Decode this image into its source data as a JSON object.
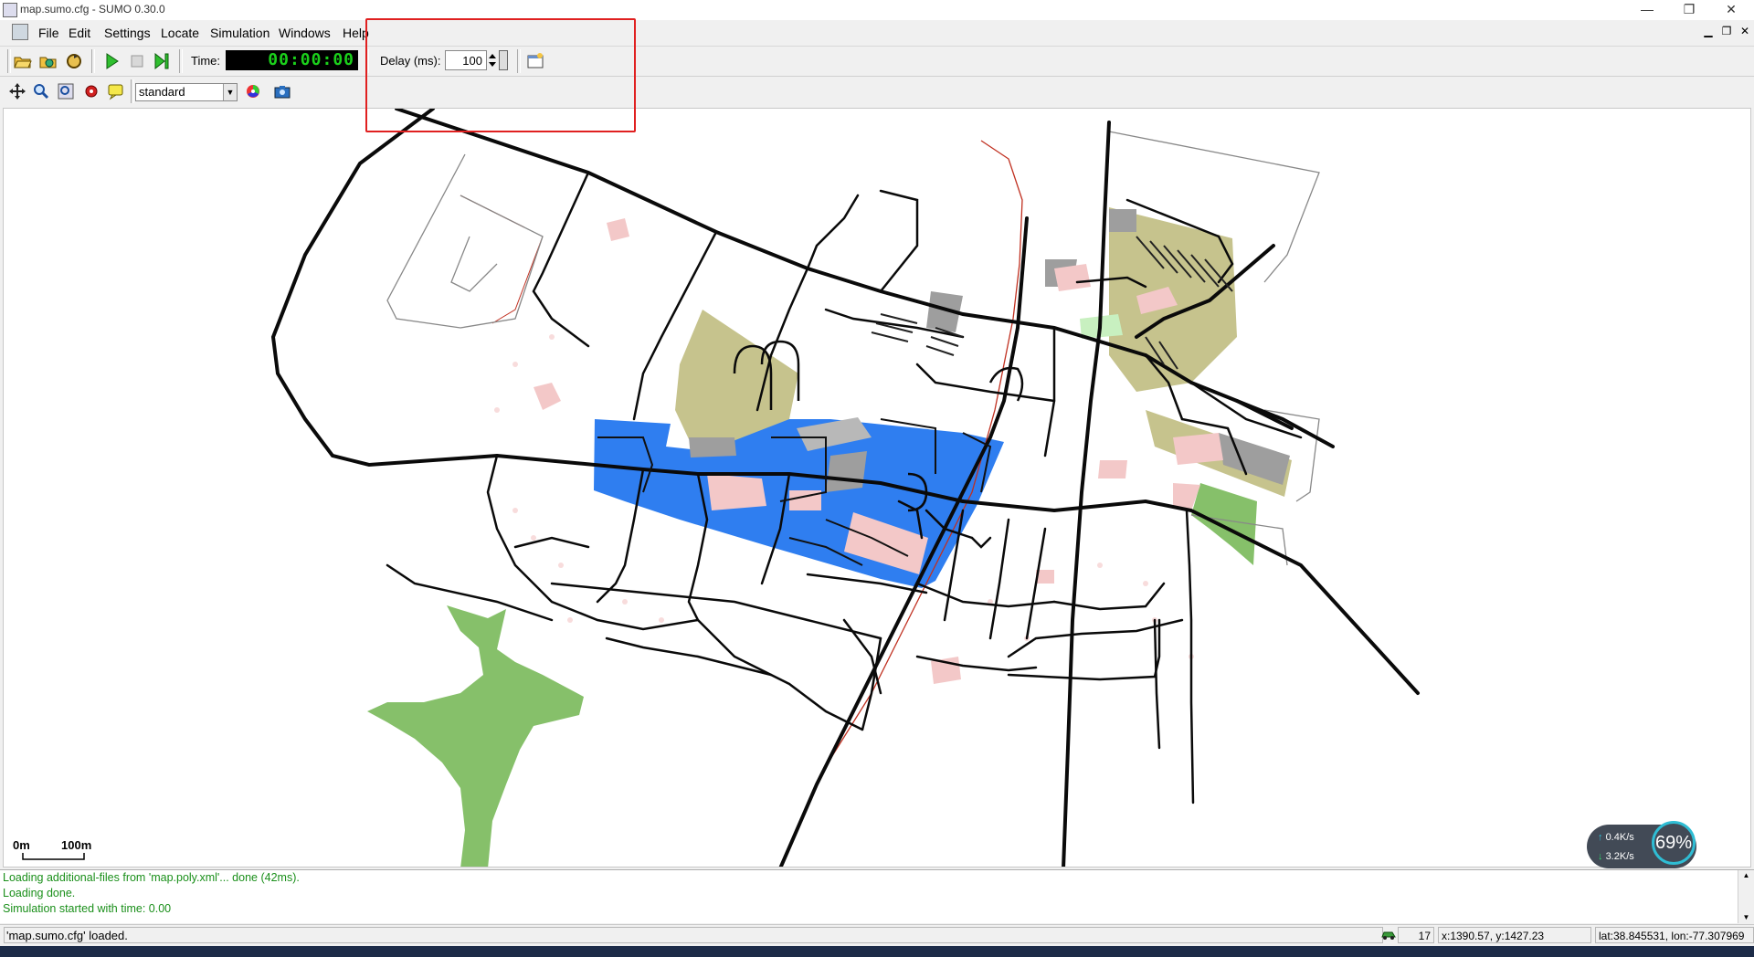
{
  "window": {
    "title": "map.sumo.cfg - SUMO 0.30.0",
    "controls": {
      "minimize": "—",
      "restore": "❐",
      "close": "✕"
    }
  },
  "menu": {
    "items": [
      "File",
      "Edit",
      "Settings",
      "Locate",
      "Simulation",
      "Windows",
      "Help"
    ]
  },
  "toolbar": {
    "time_label": "Time:",
    "time_value": "00:00:00",
    "delay_label": "Delay (ms):",
    "delay_value": "100"
  },
  "view_toolbar": {
    "scheme_value": "standard"
  },
  "map": {
    "scale_start": "0m",
    "scale_end": "100m",
    "colors": {
      "road": "#0a0a0a",
      "building": "#f3c8c8",
      "campus": "#2f7ef0",
      "park": "#7dbe5f",
      "field": "#c5c38c",
      "parking": "#9e9e9e",
      "rail": "#c03020"
    }
  },
  "net_widget": {
    "upload": "0.4K/s",
    "download": "3.2K/s",
    "percent": "69%"
  },
  "log": {
    "lines": [
      "Loading additional-files from 'map.poly.xml'... done (42ms).",
      "Loading done.",
      "Simulation started with time: 0.00"
    ]
  },
  "status": {
    "message": "'map.sumo.cfg' loaded.",
    "vehicle_count": "17",
    "xy": "x:1390.57, y:1427.23",
    "geo": "lat:38.845531, lon:-77.307969"
  }
}
